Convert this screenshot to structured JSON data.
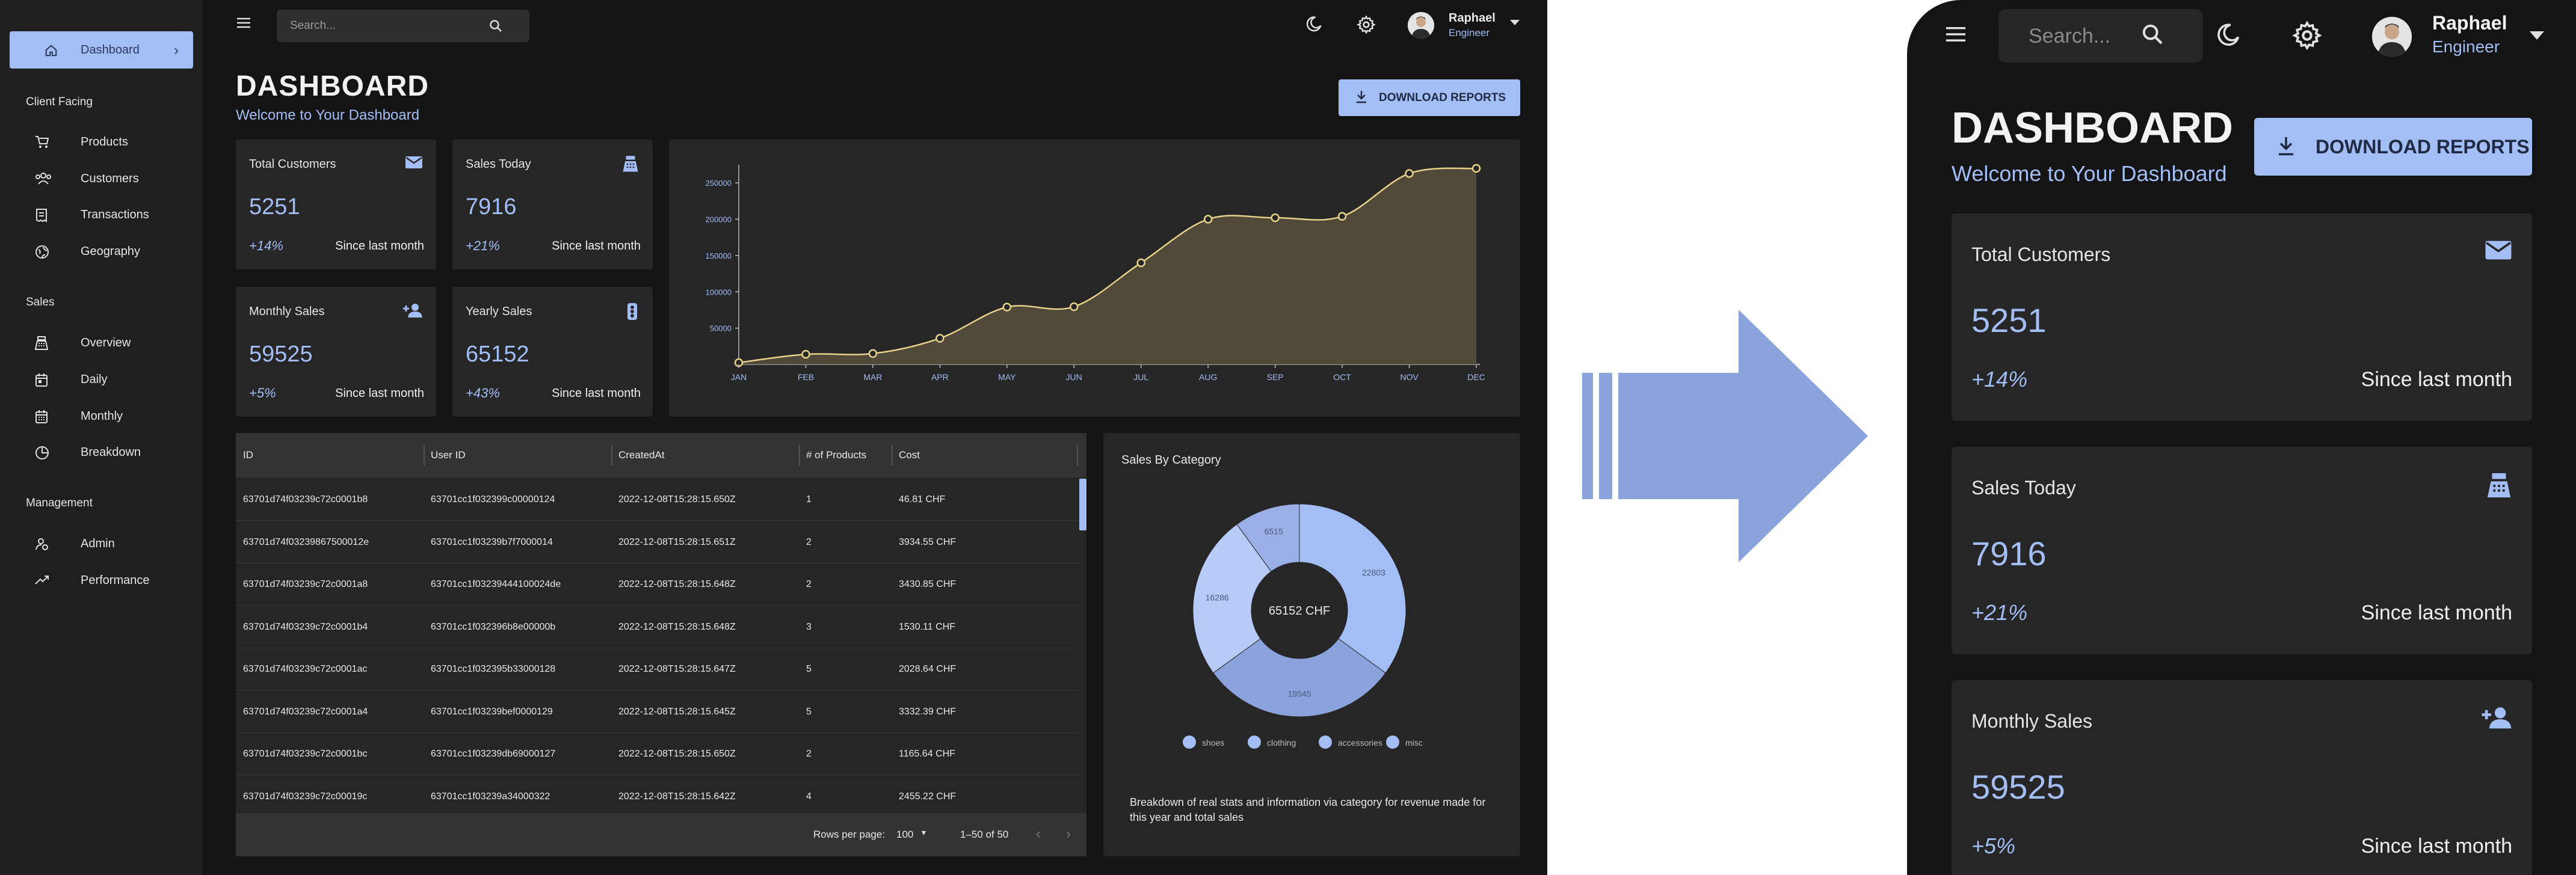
{
  "sidebar": {
    "active": {
      "label": "Dashboard"
    },
    "sections": [
      {
        "title": "Client Facing",
        "items": [
          {
            "label": "Products"
          },
          {
            "label": "Customers"
          },
          {
            "label": "Transactions"
          },
          {
            "label": "Geography"
          }
        ]
      },
      {
        "title": "Sales",
        "items": [
          {
            "label": "Overview"
          },
          {
            "label": "Daily"
          },
          {
            "label": "Monthly"
          },
          {
            "label": "Breakdown"
          }
        ]
      },
      {
        "title": "Management",
        "items": [
          {
            "label": "Admin"
          },
          {
            "label": "Performance"
          }
        ]
      }
    ]
  },
  "topbar": {
    "search_placeholder": "Search...",
    "user_name": "Raphael",
    "user_role": "Engineer"
  },
  "header": {
    "title": "DASHBOARD",
    "subtitle": "Welcome to Your Dashboard",
    "download_label": "DOWNLOAD REPORTS"
  },
  "stats": [
    {
      "title": "Total Customers",
      "value": "5251",
      "change": "+14%",
      "since": "Since last month",
      "icon": "mail-icon"
    },
    {
      "title": "Sales Today",
      "value": "7916",
      "change": "+21%",
      "since": "Since last month",
      "icon": "point-of-sale-icon"
    },
    {
      "title": "Monthly Sales",
      "value": "59525",
      "change": "+5%",
      "since": "Since last month",
      "icon": "person-add-icon"
    },
    {
      "title": "Yearly Sales",
      "value": "65152",
      "change": "+43%",
      "since": "Since last month",
      "icon": "traffic-icon"
    }
  ],
  "chart_data": [
    {
      "type": "area",
      "categories": [
        "JAN",
        "FEB",
        "MAR",
        "APR",
        "MAY",
        "JUN",
        "JUL",
        "AUG",
        "SEP",
        "OCT",
        "NOV",
        "DEC"
      ],
      "values": [
        2500,
        14000,
        15000,
        36000,
        79000,
        79500,
        140000,
        200000,
        202000,
        204000,
        263000,
        270000
      ],
      "yticks": [
        "50000",
        "100000",
        "150000",
        "200000",
        "250000"
      ],
      "ylim": [
        0,
        270000
      ],
      "grid": false
    },
    {
      "type": "pie",
      "title": "Sales By Category",
      "center_label": "65152 CHF",
      "labels": [
        "shoes",
        "clothing",
        "accessories",
        "misc"
      ],
      "values": [
        22803,
        19545,
        16286,
        6515
      ],
      "slice_labels": [
        "22803",
        "19545",
        "16286",
        "6515"
      ],
      "description": "Breakdown of real stats and information via category for revenue made for this year and total sales"
    }
  ],
  "grid": {
    "columns": [
      "ID",
      "User ID",
      "CreatedAt",
      "# of Products",
      "Cost"
    ],
    "rows": [
      [
        "63701d74f03239c72c0001b8",
        "63701cc1f032399c00000124",
        "2022-12-08T15:28:15.650Z",
        "1",
        "46.81 CHF"
      ],
      [
        "63701d74f03239867500012e",
        "63701cc1f03239b7f7000014",
        "2022-12-08T15:28:15.651Z",
        "2",
        "3934.55 CHF"
      ],
      [
        "63701d74f03239c72c0001a8",
        "63701cc1f03239444100024de",
        "2022-12-08T15:28:15.648Z",
        "2",
        "3430.85 CHF"
      ],
      [
        "63701d74f03239c72c0001b4",
        "63701cc1f032396b8e00000b",
        "2022-12-08T15:28:15.648Z",
        "3",
        "1530.11 CHF"
      ],
      [
        "63701d74f03239c72c0001ac",
        "63701cc1f032395b33000128",
        "2022-12-08T15:28:15.647Z",
        "5",
        "2028.64 CHF"
      ],
      [
        "63701d74f03239c72c0001a4",
        "63701cc1f03239bef0000129",
        "2022-12-08T15:28:15.645Z",
        "5",
        "3332.39 CHF"
      ],
      [
        "63701d74f03239c72c0001bc",
        "63701cc1f03239db69000127",
        "2022-12-08T15:28:15.650Z",
        "2",
        "1165.64 CHF"
      ],
      [
        "63701d74f03239c72c00019c",
        "63701cc1f03239a34000322",
        "2022-12-08T15:28:15.642Z",
        "4",
        "2455.22 CHF"
      ]
    ],
    "footer": {
      "rows_per_page_label": "Rows per page:",
      "rows_per_page": "100",
      "range": "1–50 of 50"
    }
  },
  "mobile": {
    "search_placeholder": "Search...",
    "user_name": "Raphael",
    "user_role": "Engineer",
    "title": "DASHBOARD",
    "subtitle": "Welcome to Your Dashboard",
    "download_label": "DOWNLOAD REPORTS"
  },
  "colors": {
    "accent": "#a3bdf5",
    "background": "#141414",
    "surface": "#262626",
    "chart_line": "#e6d28a",
    "chart_fill": "#57513d"
  }
}
